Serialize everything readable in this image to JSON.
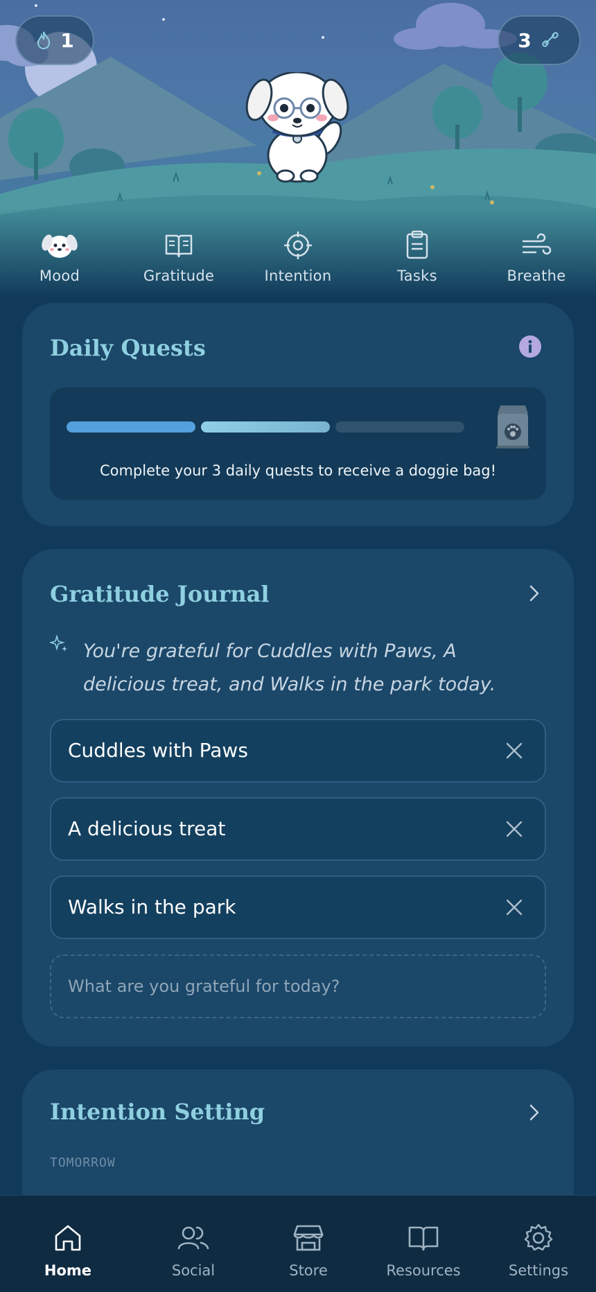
{
  "header": {
    "streak_count": "1",
    "bones_count": "3"
  },
  "quick_actions": [
    {
      "label": "Mood",
      "icon": "dog-face-icon"
    },
    {
      "label": "Gratitude",
      "icon": "open-book-icon"
    },
    {
      "label": "Intention",
      "icon": "target-icon"
    },
    {
      "label": "Tasks",
      "icon": "clipboard-icon"
    },
    {
      "label": "Breathe",
      "icon": "wind-icon"
    }
  ],
  "daily_quests": {
    "title": "Daily Quests",
    "completed": 2,
    "total": 3,
    "message": "Complete your 3 daily quests to receive a doggie bag!"
  },
  "gratitude": {
    "title": "Gratitude Journal",
    "summary": "You're grateful for Cuddles with Paws, A delicious treat, and Walks in the park today.",
    "entries": [
      "Cuddles with Paws",
      "A delicious treat",
      "Walks in the park"
    ],
    "placeholder": "What are you grateful for today?"
  },
  "intention": {
    "title": "Intention Setting",
    "label": "TOMORROW"
  },
  "nav": [
    {
      "label": "Home",
      "active": true
    },
    {
      "label": "Social",
      "active": false
    },
    {
      "label": "Store",
      "active": false
    },
    {
      "label": "Resources",
      "active": false
    },
    {
      "label": "Settings",
      "active": false
    }
  ],
  "colors": {
    "background": "#113a5a",
    "card": "#1b4769",
    "title_accent": "#8fd0e0",
    "progress_blue": "#53a0dc"
  }
}
